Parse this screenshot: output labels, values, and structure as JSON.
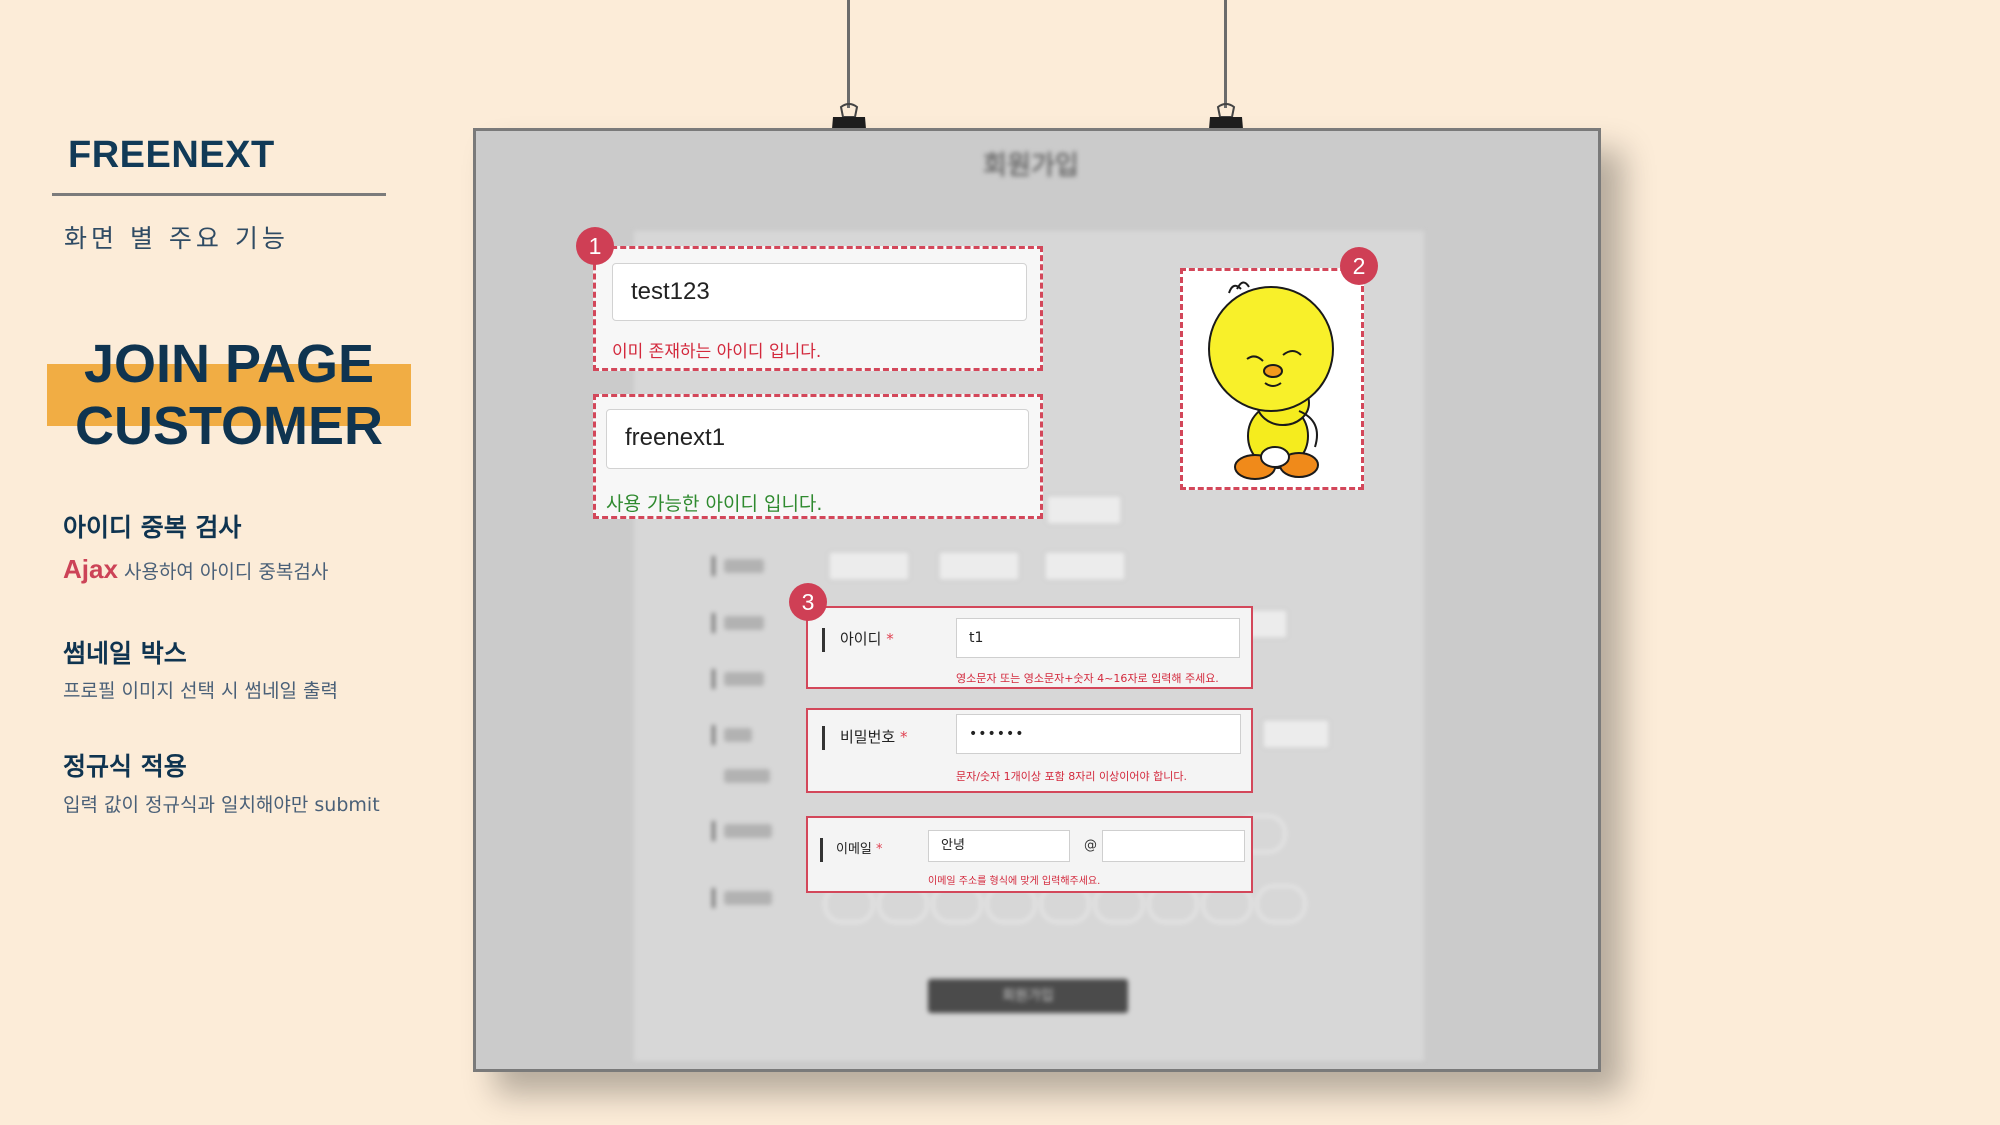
{
  "sidebar": {
    "brand": "FREENEXT",
    "subtitle": "화면 별 주요 기능",
    "title_line1": "JOIN PAGE",
    "title_line2": "CUSTOMER",
    "features": [
      {
        "heading": "아이디 중복 검사",
        "prefix": "Ajax",
        "desc": " 사용하여 아이디 중복검사"
      },
      {
        "heading": "썸네일 박스",
        "desc": "프로필 이미지 선택 시 썸네일 출력"
      },
      {
        "heading": "정규식 적용",
        "desc": "입력 값이 정규식과 일치해야만 submit"
      }
    ]
  },
  "poster": {
    "form_title": "회원가입",
    "section1": {
      "badge": "1",
      "dup_value": "test123",
      "dup_message": "이미 존재하는 아이디 입니다.",
      "ok_value": "freenext1",
      "ok_message": "사용 가능한 아이디 입니다."
    },
    "section2": {
      "badge": "2",
      "image": "yellow-bird-thumbnail"
    },
    "section3": {
      "badge": "3",
      "id": {
        "label": "아이디",
        "required": "*",
        "value": "t1",
        "hint": "영소문자 또는 영소문자+숫자 4~16자로 입력해 주세요."
      },
      "password": {
        "label": "비밀번호",
        "required": "*",
        "value": "••••••",
        "hint": "문자/숫자 1개이상 포함 8자리 이상이어야 합니다."
      },
      "email": {
        "label": "이메일",
        "required": "*",
        "local": "안녕",
        "at": "@",
        "domain": "",
        "hint": "이메일 주소를 형식에 맞게 입력해주세요."
      }
    },
    "submit_label": "회원가입"
  },
  "colors": {
    "background": "#fcecd8",
    "accent": "#f1ad44",
    "navy": "#0f3450",
    "highlight": "#d3475a",
    "error": "#d3283c",
    "success": "#2f8a2f"
  }
}
